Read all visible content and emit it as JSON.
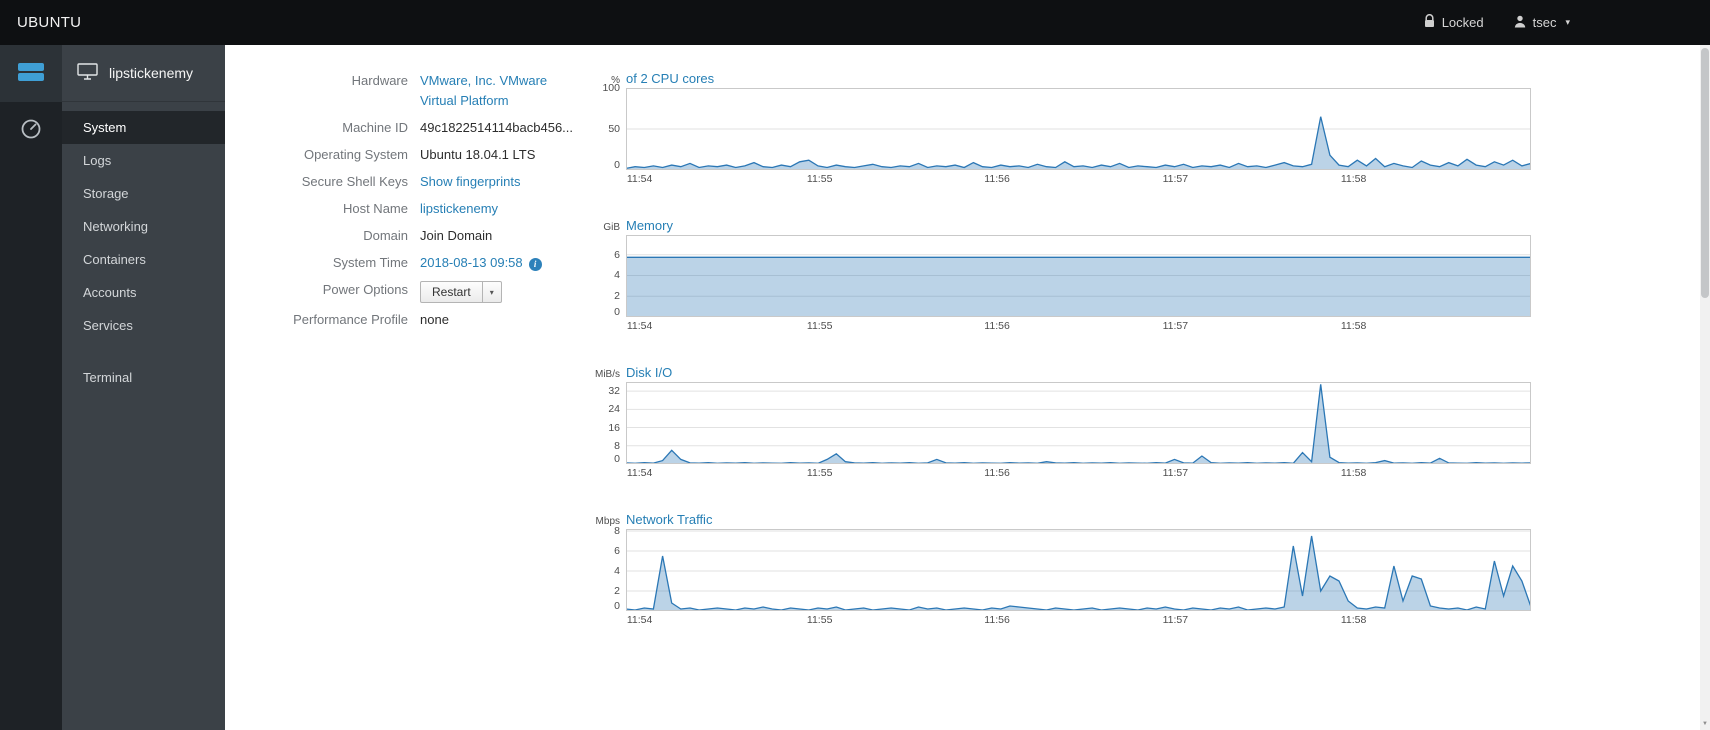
{
  "topbar": {
    "brand": "UBUNTU",
    "locked_label": "Locked",
    "user_label": "tsec"
  },
  "icons": {
    "caret_down": "▾",
    "scroll_up": "▲",
    "scroll_down": "▼",
    "info": "i"
  },
  "sidebar": {
    "host": "lipstickenemy",
    "items": [
      {
        "label": "System",
        "active": true
      },
      {
        "label": "Logs"
      },
      {
        "label": "Storage"
      },
      {
        "label": "Networking"
      },
      {
        "label": "Containers"
      },
      {
        "label": "Accounts"
      },
      {
        "label": "Services"
      },
      {
        "label": "Terminal",
        "separated": true
      }
    ]
  },
  "system": {
    "rows": [
      {
        "label": "Hardware",
        "kind": "links",
        "lines": [
          "VMware, Inc. VMware",
          "Virtual Platform"
        ]
      },
      {
        "label": "Machine ID",
        "kind": "text",
        "value": "49c1822514114bacb456..."
      },
      {
        "label": "Operating System",
        "kind": "text",
        "value": "Ubuntu 18.04.1 LTS"
      },
      {
        "label": "Secure Shell Keys",
        "kind": "link",
        "value": "Show fingerprints"
      },
      {
        "label": "Host Name",
        "kind": "link",
        "value": "lipstickenemy"
      },
      {
        "label": "Domain",
        "kind": "textlink",
        "value": "Join Domain"
      },
      {
        "label": "System Time",
        "kind": "time",
        "value": "2018-08-13 09:58"
      },
      {
        "label": "Power Options",
        "kind": "power",
        "value": "Restart"
      },
      {
        "label": "Performance Profile",
        "kind": "text",
        "value": "none"
      }
    ]
  },
  "chart_data": [
    {
      "id": "cpu",
      "type": "area",
      "unit": "%",
      "title": "of 2 CPU cores",
      "x_ticks": [
        "11:54",
        "11:55",
        "11:56",
        "11:57",
        "11:58"
      ],
      "x_tick_fractions": [
        0.015,
        0.214,
        0.41,
        0.607,
        0.804
      ],
      "yticks": [
        0,
        50,
        100
      ],
      "ylim": [
        0,
        100
      ],
      "values": [
        2,
        4,
        3,
        5,
        3,
        6,
        4,
        8,
        3,
        5,
        4,
        6,
        3,
        5,
        9,
        4,
        3,
        6,
        4,
        10,
        12,
        5,
        3,
        6,
        4,
        3,
        5,
        7,
        4,
        3,
        5,
        4,
        8,
        3,
        5,
        4,
        6,
        3,
        9,
        4,
        3,
        6,
        4,
        5,
        3,
        7,
        4,
        3,
        10,
        4,
        5,
        3,
        6,
        4,
        8,
        3,
        5,
        4,
        3,
        6,
        4,
        7,
        3,
        5,
        4,
        6,
        3,
        8,
        4,
        5,
        3,
        6,
        9,
        5,
        4,
        7,
        65,
        18,
        6,
        4,
        12,
        5,
        14,
        4,
        8,
        5,
        3,
        11,
        6,
        4,
        9,
        5,
        13,
        6,
        4,
        10,
        6,
        12,
        5,
        8
      ]
    },
    {
      "id": "memory",
      "type": "area",
      "unit": "GiB",
      "title": "Memory",
      "x_ticks": [
        "11:54",
        "11:55",
        "11:56",
        "11:57",
        "11:58"
      ],
      "x_tick_fractions": [
        0.015,
        0.214,
        0.41,
        0.607,
        0.804
      ],
      "yticks": [
        0,
        2,
        4,
        6
      ],
      "ylim": [
        0,
        7.9
      ],
      "values": [
        5.75,
        5.75
      ]
    },
    {
      "id": "disk-io",
      "type": "area",
      "unit": "MiB/s",
      "title": "Disk I/O",
      "x_ticks": [
        "11:54",
        "11:55",
        "11:56",
        "11:57",
        "11:58"
      ],
      "x_tick_fractions": [
        0.015,
        0.214,
        0.41,
        0.607,
        0.804
      ],
      "yticks": [
        0,
        8,
        16,
        24,
        32
      ],
      "ylim": [
        0,
        36
      ],
      "values": [
        0.5,
        0.3,
        0.6,
        0.4,
        1.5,
        6,
        2,
        0.5,
        0.4,
        0.6,
        0.3,
        0.5,
        0.4,
        0.6,
        0.3,
        0.5,
        0.4,
        0.3,
        0.6,
        0.4,
        0.5,
        0.3,
        2,
        4.5,
        1,
        0.5,
        0.4,
        0.6,
        0.3,
        0.5,
        0.4,
        0.6,
        0.3,
        0.5,
        2,
        0.5,
        0.4,
        0.6,
        0.3,
        0.5,
        0.4,
        0.3,
        0.6,
        0.4,
        0.5,
        0.3,
        1,
        0.5,
        0.4,
        0.6,
        0.3,
        0.5,
        0.4,
        0.6,
        0.3,
        0.5,
        0.4,
        0.3,
        0.6,
        0.4,
        2,
        0.5,
        0.4,
        3.5,
        0.6,
        0.3,
        0.5,
        0.4,
        0.6,
        0.3,
        0.5,
        0.4,
        0.6,
        0.3,
        5,
        1,
        35,
        3,
        0.6,
        0.4,
        0.5,
        0.3,
        0.6,
        1.5,
        0.4,
        0.5,
        0.3,
        0.6,
        0.4,
        2.5,
        0.5,
        0.4,
        0.3,
        0.6,
        0.4,
        0.5,
        0.3,
        0.5,
        0.4,
        0.5
      ]
    },
    {
      "id": "network-traffic",
      "type": "area",
      "unit": "Mbps",
      "title": "Network Traffic",
      "x_ticks": [
        "11:54",
        "11:55",
        "11:56",
        "11:57",
        "11:58"
      ],
      "x_tick_fractions": [
        0.015,
        0.214,
        0.41,
        0.607,
        0.804
      ],
      "yticks": [
        0,
        2,
        4,
        6,
        8
      ],
      "ylim": [
        0,
        8.2
      ],
      "values": [
        0.2,
        0.1,
        0.3,
        0.2,
        5.5,
        0.8,
        0.2,
        0.3,
        0.1,
        0.2,
        0.3,
        0.2,
        0.1,
        0.3,
        0.2,
        0.4,
        0.2,
        0.1,
        0.3,
        0.2,
        0.1,
        0.3,
        0.2,
        0.4,
        0.1,
        0.2,
        0.3,
        0.1,
        0.2,
        0.3,
        0.2,
        0.1,
        0.4,
        0.2,
        0.3,
        0.1,
        0.2,
        0.3,
        0.2,
        0.1,
        0.3,
        0.2,
        0.5,
        0.4,
        0.3,
        0.2,
        0.1,
        0.3,
        0.2,
        0.1,
        0.2,
        0.3,
        0.1,
        0.2,
        0.3,
        0.2,
        0.1,
        0.3,
        0.2,
        0.4,
        0.2,
        0.1,
        0.3,
        0.2,
        0.1,
        0.3,
        0.2,
        0.4,
        0.1,
        0.2,
        0.3,
        0.2,
        0.4,
        6.5,
        1.5,
        7.5,
        2,
        3.5,
        3,
        1,
        0.3,
        0.2,
        0.4,
        0.3,
        4.5,
        1,
        3.5,
        3.2,
        0.5,
        0.3,
        0.2,
        0.3,
        0.1,
        0.4,
        0.2,
        5,
        1.5,
        4.5,
        3,
        0.4
      ]
    }
  ],
  "colors": {
    "link": "#267fb5",
    "chart_line": "#2b77b5",
    "topbar_bg": "#0e1012",
    "sidebar_bg": "#3b4147"
  }
}
